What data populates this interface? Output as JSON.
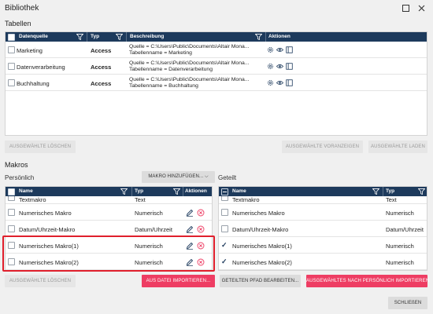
{
  "window": {
    "title": "Bibliothek"
  },
  "tables_section": {
    "title": "Tabellen",
    "headers": {
      "source": "Datenquelle",
      "type": "Typ",
      "description": "Beschreibung",
      "actions": "Aktionen"
    },
    "rows": [
      {
        "source": "Marketing",
        "type": "Access",
        "desc1": "Quelle = C:\\Users\\Public\\Documents\\Altair Mona...",
        "desc2": "Tabellenname = Marketing"
      },
      {
        "source": "Datenverarbeitung",
        "type": "Access",
        "desc1": "Quelle = C:\\Users\\Public\\Documents\\Altair Mona...",
        "desc2": "Tabellenname = Datenverarbeitung"
      },
      {
        "source": "Buchhaltung",
        "type": "Access",
        "desc1": "Quelle = C:\\Users\\Public\\Documents\\Altair Mona...",
        "desc2": "Tabellenname = Buchhaltung"
      }
    ],
    "buttons": {
      "delete_selected": "AUSGEWÄHLTE LÖSCHEN",
      "preview_selected": "AUSGEWÄHLTE VORANZEIGEN",
      "load_selected": "AUSGEWÄHLTE LADEN"
    }
  },
  "macros_section": {
    "title": "Makros",
    "personal_label": "Persönlich",
    "shared_label": "Geteilt",
    "add_macro_button": "MAKRO HINZUFÜGEN...",
    "personal": {
      "headers": {
        "name": "Name",
        "type": "Typ",
        "actions": "Aktionen"
      },
      "rows": [
        {
          "name": "Textmakro",
          "type": "Text"
        },
        {
          "name": "Numerisches Makro",
          "type": "Numerisch"
        },
        {
          "name": "Datum/Uhrzeit-Makro",
          "type": "Datum/Uhrzeit"
        },
        {
          "name": "Numerisches Makro(1)",
          "type": "Numerisch"
        },
        {
          "name": "Numerisches Makro(2)",
          "type": "Numerisch"
        }
      ]
    },
    "shared": {
      "headers": {
        "name": "Name",
        "type": "Typ"
      },
      "rows": [
        {
          "name": "Textmakro",
          "type": "Text",
          "checked": false
        },
        {
          "name": "Numerisches Makro",
          "type": "Numerisch",
          "checked": false
        },
        {
          "name": "Datum/Uhrzeit-Makro",
          "type": "Datum/Uhrzeit",
          "checked": false
        },
        {
          "name": "Numerisches Makro(1)",
          "type": "Numerisch",
          "checked": true
        },
        {
          "name": "Numerisches Makro(2)",
          "type": "Numerisch",
          "checked": true
        }
      ]
    },
    "buttons": {
      "delete_selected": "AUSGEWÄHLTE LÖSCHEN",
      "import_from_file": "AUS DATEI IMPORTIEREN...",
      "edit_shared_path": "GETEILTEN PFAD BEARBEITEN...",
      "import_to_personal": "AUSGEWÄHLTES NACH PERSÖNLICH IMPORTIEREN"
    }
  },
  "footer": {
    "close_button": "SCHLIEßEN"
  },
  "icons": {
    "maximize": "maximize-icon",
    "close": "close-icon",
    "filter": "funnel-icon",
    "settings": "gear-icon",
    "preview": "eye-icon",
    "open": "book-icon",
    "edit": "pencil-icon",
    "delete": "delete-circle-icon"
  },
  "colors": {
    "header": "#1d3a5c",
    "accent": "#ee3d63",
    "highlight": "#e01f2c"
  }
}
